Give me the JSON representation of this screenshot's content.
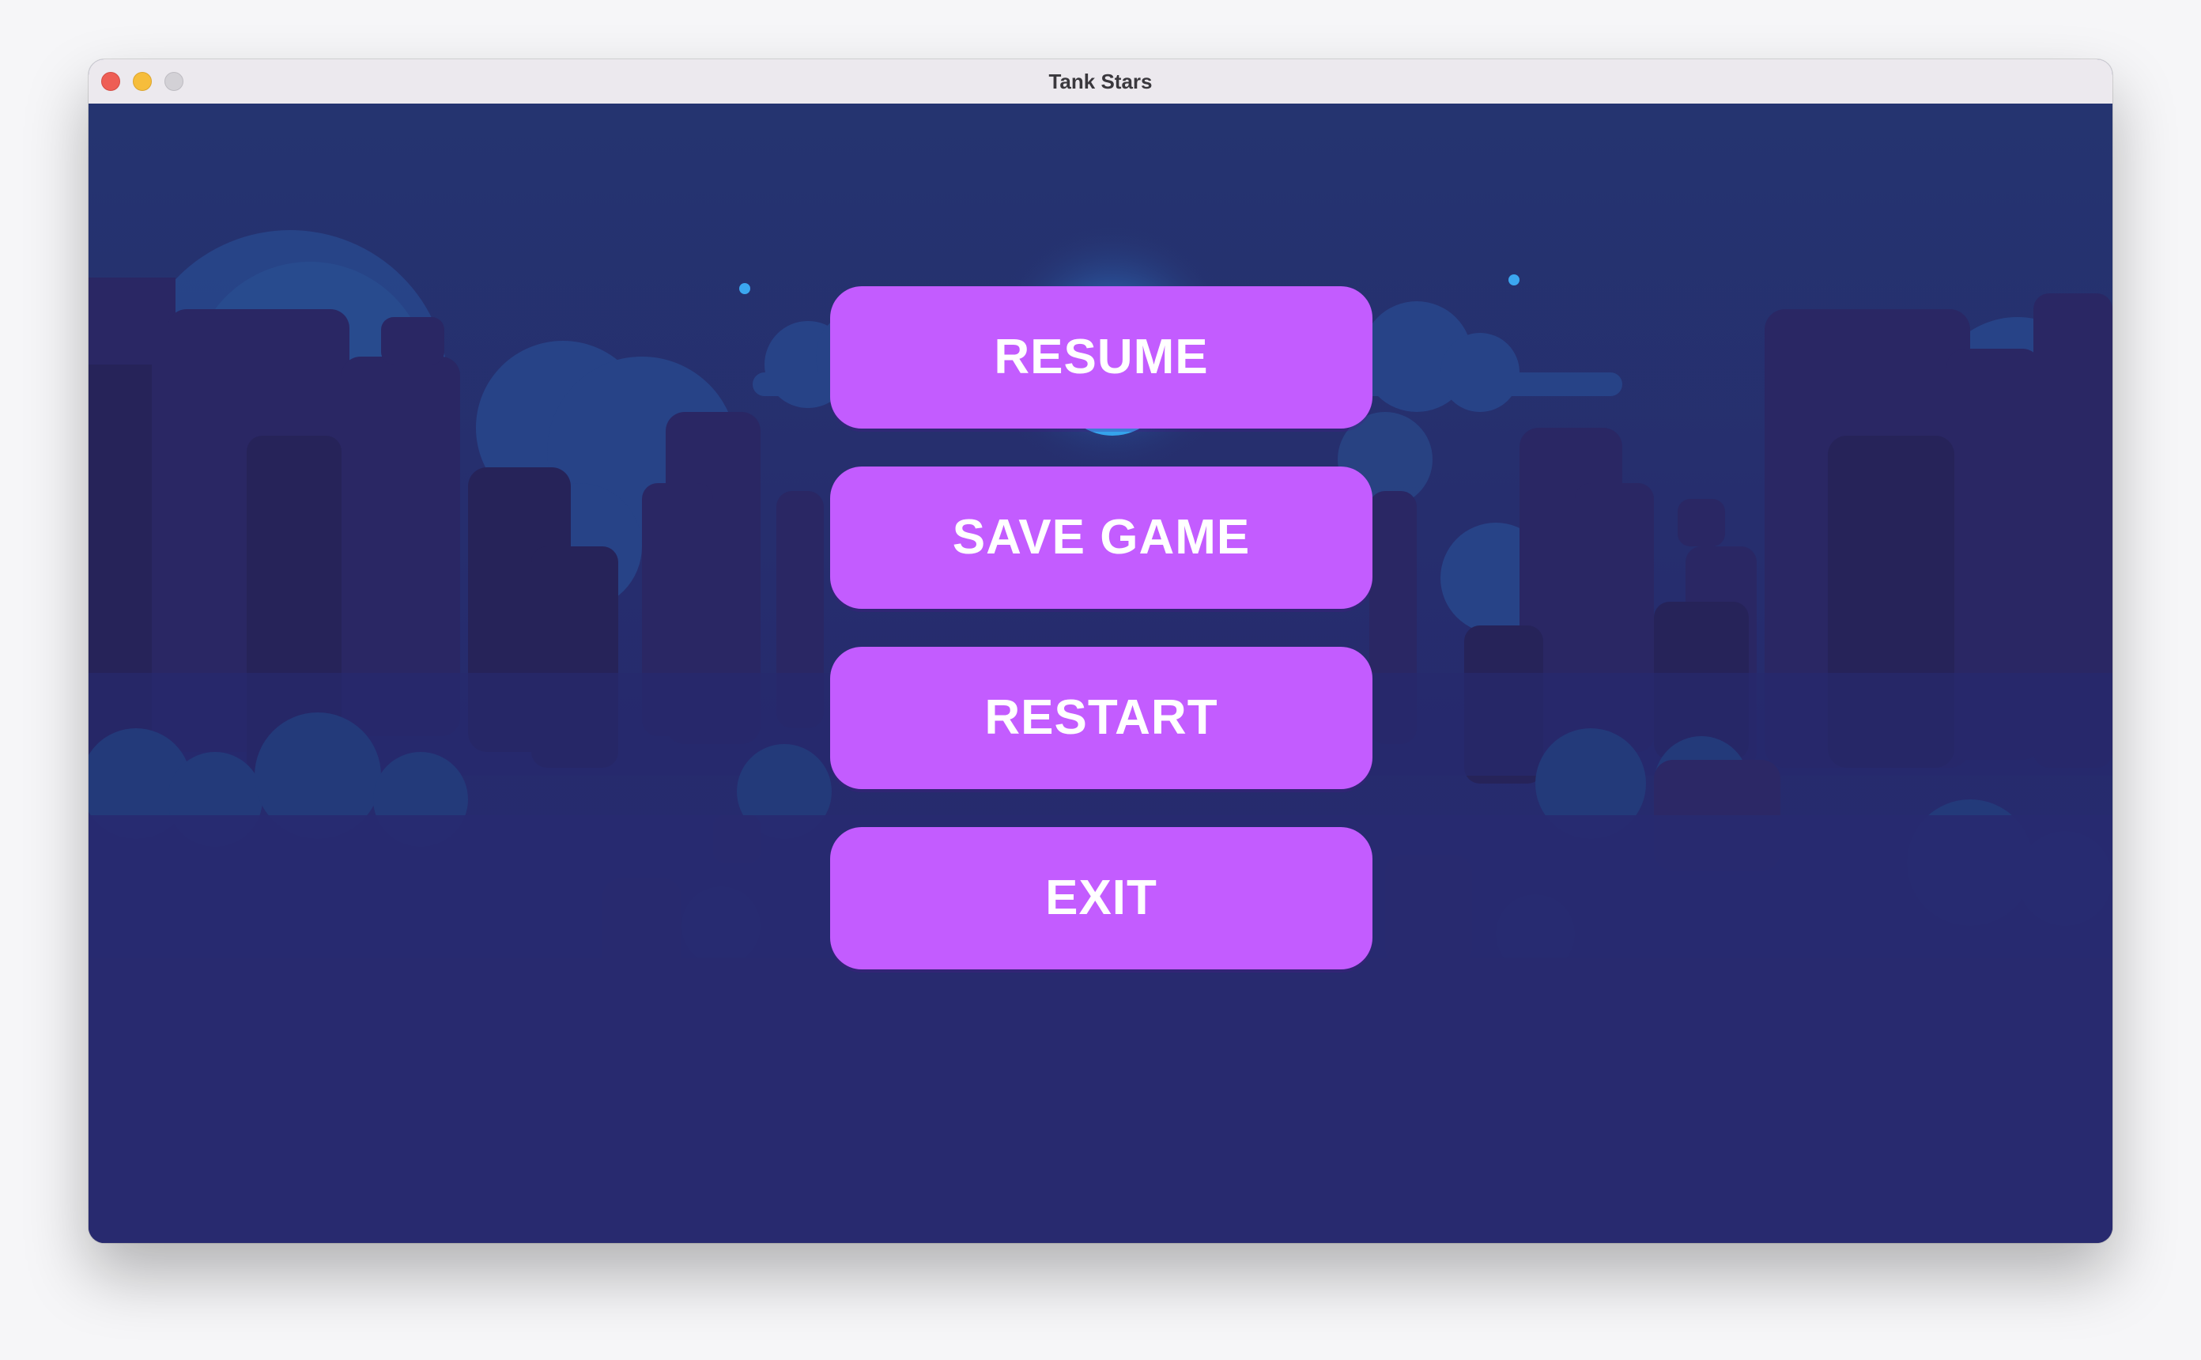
{
  "window": {
    "title": "Tank Stars"
  },
  "pause_menu": {
    "resume_label": "RESUME",
    "save_game_label": "SAVE GAME",
    "restart_label": "RESTART",
    "exit_label": "EXIT"
  },
  "colors": {
    "background": "#272b6f",
    "button": "#c35cff",
    "button_text": "#ffffff",
    "titlebar": "#ece9ee"
  },
  "icons": [
    "close-window-icon",
    "minimize-window-icon",
    "zoom-window-icon"
  ]
}
